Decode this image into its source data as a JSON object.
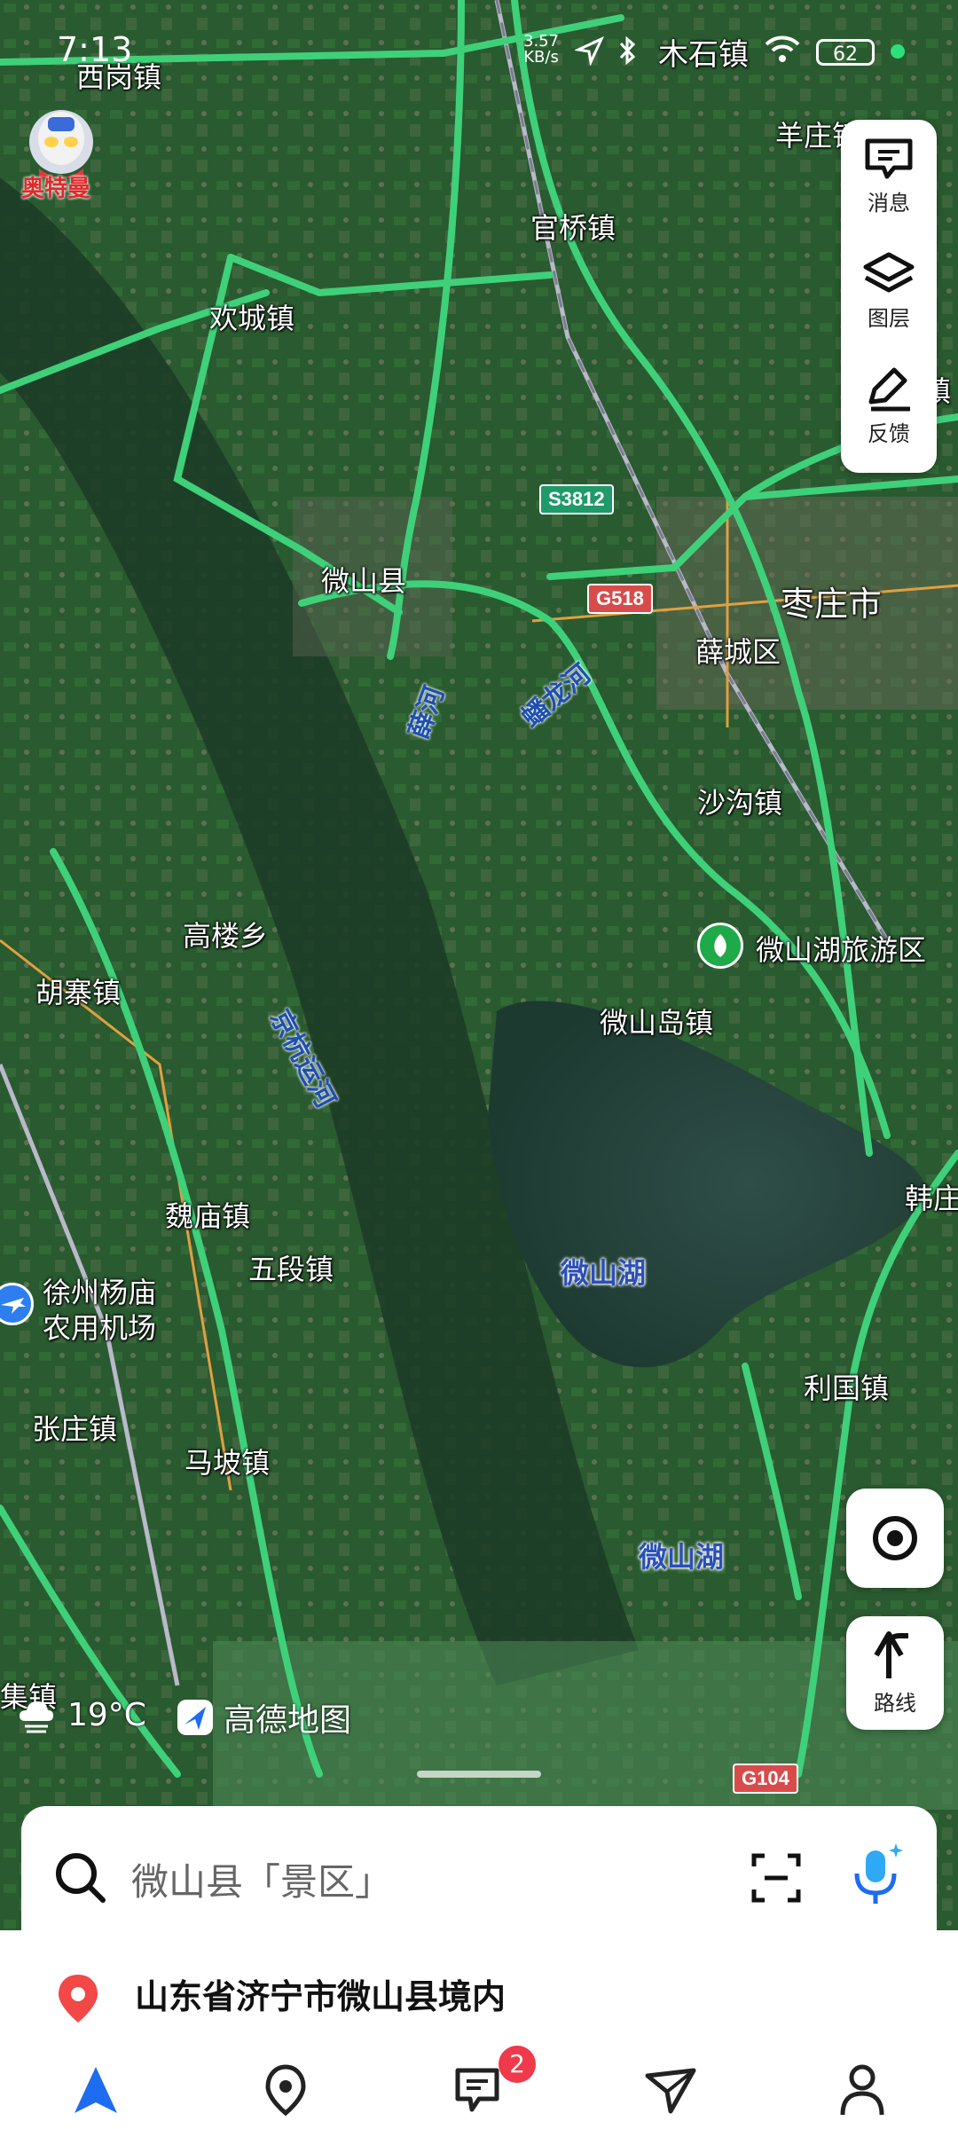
{
  "status_bar": {
    "time": "7:13",
    "net_speed_value": "3.57",
    "net_speed_unit": "KB/s",
    "battery": "62",
    "location_label": "木石镇"
  },
  "map": {
    "place_labels": {
      "xigang": "西岗镇",
      "yangzhuang": "羊庄镇",
      "guanqiao": "官桥镇",
      "huancheng": "欢城镇",
      "weishanxian": "微山县",
      "zaozhuang": "枣庄市",
      "xuecheng": "薛城区",
      "shagou": "沙沟镇",
      "gaolou": "高楼乡",
      "huzhai": "胡寨镇",
      "weishandao": "微山岛镇",
      "weimiao": "魏庙镇",
      "wuduan": "五段镇",
      "airport_line1": "徐州杨庙",
      "airport_line2": "农用机场",
      "zhangzhuang": "张庄镇",
      "mapo": "马坡镇",
      "liguo": "利国镇",
      "hanzhuang": "韩庄",
      "jizhen": "集镇",
      "edge_right": "镇",
      "scenic": "微山湖旅游区"
    },
    "water_labels": {
      "lake1": "微山湖",
      "lake2": "微山湖",
      "xuehe": "薛河",
      "jinglong": "蟠龙河",
      "jinghang": "京杭运河"
    },
    "road_shields": {
      "s3812": "S3812",
      "g518": "G518",
      "g104": "G104"
    }
  },
  "logo_text": "奥特曼",
  "toolbox": {
    "messages": "消息",
    "layers": "图层",
    "feedback": "反馈"
  },
  "route_button": "路线",
  "weather": {
    "temp": "19°C"
  },
  "brand": "高德地图",
  "search": {
    "placeholder": "微山县「景区」"
  },
  "location_text": "山东省济宁市微山县境内",
  "nav": {
    "messages_badge": "2"
  },
  "colors": {
    "road": "#3fd07a",
    "lake": "#2c4b44",
    "accent": "#1e6cf0",
    "badge": "#f0394a"
  }
}
